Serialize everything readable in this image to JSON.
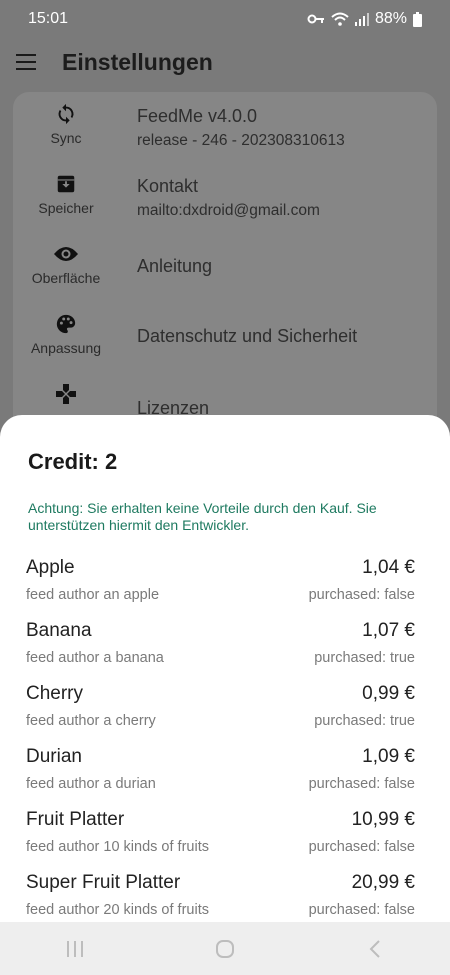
{
  "status_bar": {
    "time": "15:01",
    "battery": "88%",
    "icons": [
      "key-icon",
      "wifi-icon",
      "signal-icon",
      "battery-icon"
    ]
  },
  "app_bar": {
    "title": "Einstellungen",
    "menu_icon": "menu-icon"
  },
  "settings": {
    "categories": [
      {
        "label": "Sync",
        "icon": "sync-icon"
      },
      {
        "label": "Speicher",
        "icon": "archive-icon"
      },
      {
        "label": "Oberfläche",
        "icon": "eye-icon"
      },
      {
        "label": "Anpassung",
        "icon": "palette-icon"
      },
      {
        "label": "",
        "icon": "gamepad-icon"
      }
    ],
    "entries": [
      {
        "title": "FeedMe v4.0.0",
        "subtitle": "release - 246 - 202308310613"
      },
      {
        "title": "Kontakt",
        "subtitle": "mailto:dxdroid@gmail.com"
      },
      {
        "title": "Anleitung"
      },
      {
        "title": "Datenschutz und Sicherheit"
      },
      {
        "title": "Lizenzen"
      }
    ]
  },
  "sheet": {
    "credit": "Credit: 2",
    "notice": "Achtung: Sie erhalten keine Vorteile durch den Kauf. Sie unterstützen hiermit den Entwickler.",
    "products": [
      {
        "name": "Apple",
        "description": "feed author an apple",
        "price": "1,04 €",
        "status": "purchased: false"
      },
      {
        "name": "Banana",
        "description": "feed author a banana",
        "price": "1,07 €",
        "status": "purchased: true"
      },
      {
        "name": "Cherry",
        "description": "feed author a cherry",
        "price": "0,99 €",
        "status": "purchased: true"
      },
      {
        "name": "Durian",
        "description": "feed author a durian",
        "price": "1,09 €",
        "status": "purchased: false"
      },
      {
        "name": "Fruit Platter",
        "description": "feed author 10 kinds of fruits",
        "price": "10,99 €",
        "status": "purchased: false"
      },
      {
        "name": "Super Fruit Platter",
        "description": "feed author 20 kinds of fruits",
        "price": "20,99 €",
        "status": "purchased: false"
      }
    ]
  },
  "colors": {
    "scrim": "#7a7a7a",
    "notice_text": "#1e7a60",
    "sheet_bg": "#ffffff",
    "navbar_bg": "#eeeeee"
  }
}
